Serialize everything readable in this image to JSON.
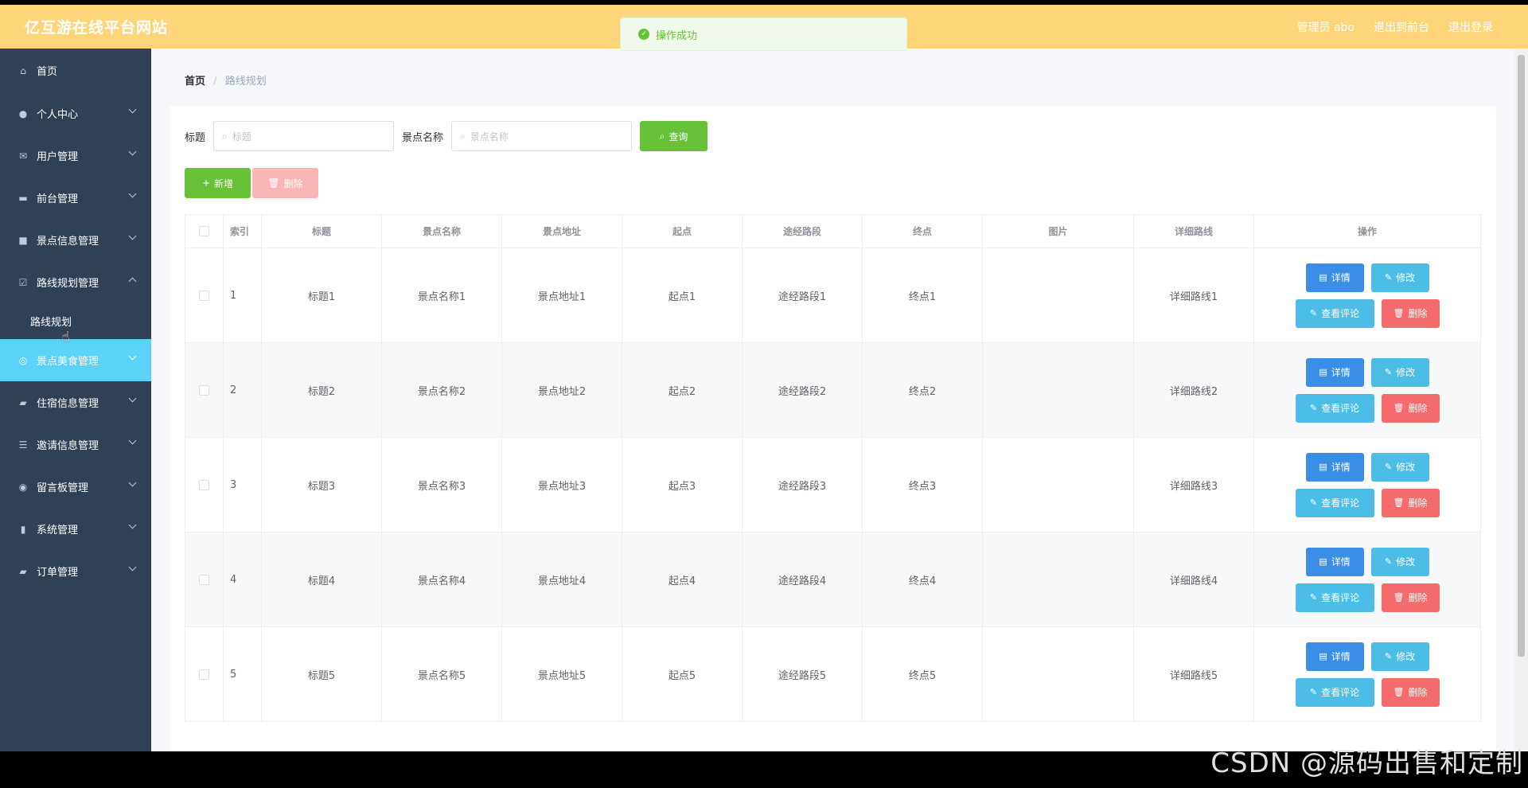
{
  "header": {
    "brand": "亿互游在线平台网站",
    "admin": "管理员 abo",
    "back_frontend": "退出到前台",
    "logout": "退出登录"
  },
  "toast": {
    "message": "操作成功"
  },
  "sidebar": {
    "items": [
      {
        "label": "首页",
        "icon": "home-icon"
      },
      {
        "label": "个人中心",
        "icon": "user-icon"
      },
      {
        "label": "用户管理",
        "icon": "mail-icon"
      },
      {
        "label": "前台管理",
        "icon": "printer-icon"
      },
      {
        "label": "景点信息管理",
        "icon": "briefcase-icon"
      },
      {
        "label": "路线规划管理",
        "icon": "checklist-icon"
      },
      {
        "label": "路线规划",
        "icon": ""
      },
      {
        "label": "景点美食管理",
        "icon": "compass-icon"
      },
      {
        "label": "住宿信息管理",
        "icon": "wallet-icon"
      },
      {
        "label": "邀请信息管理",
        "icon": "sliders-icon"
      },
      {
        "label": "留言板管理",
        "icon": "target-icon"
      },
      {
        "label": "系统管理",
        "icon": "chart-icon"
      },
      {
        "label": "订单管理",
        "icon": "chat-icon"
      }
    ]
  },
  "breadcrumb": {
    "home": "首页",
    "current": "路线规划"
  },
  "search": {
    "title_label": "标题",
    "title_placeholder": "标题",
    "spot_label": "景点名称",
    "spot_placeholder": "景点名称",
    "query": "查询"
  },
  "actions": {
    "add": "新增",
    "delete": "删除"
  },
  "table": {
    "headers": [
      "索引",
      "标题",
      "景点名称",
      "景点地址",
      "起点",
      "途经路段",
      "终点",
      "图片",
      "详细路线",
      "操作"
    ],
    "rows": [
      {
        "idx": "1",
        "title": "标题1",
        "spot": "景点名称1",
        "addr": "景点地址1",
        "start": "起点1",
        "via": "途经路段1",
        "end": "终点1",
        "route": "详细路线1"
      },
      {
        "idx": "2",
        "title": "标题2",
        "spot": "景点名称2",
        "addr": "景点地址2",
        "start": "起点2",
        "via": "途经路段2",
        "end": "终点2",
        "route": "详细路线2"
      },
      {
        "idx": "3",
        "title": "标题3",
        "spot": "景点名称3",
        "addr": "景点地址3",
        "start": "起点3",
        "via": "途经路段3",
        "end": "终点3",
        "route": "详细路线3"
      },
      {
        "idx": "4",
        "title": "标题4",
        "spot": "景点名称4",
        "addr": "景点地址4",
        "start": "起点4",
        "via": "途经路段4",
        "end": "终点4",
        "route": "详细路线4"
      },
      {
        "idx": "5",
        "title": "标题5",
        "spot": "景点名称5",
        "addr": "景点地址5",
        "start": "起点5",
        "via": "途经路段5",
        "end": "终点5",
        "route": "详细路线5"
      }
    ],
    "op_labels": {
      "detail": "详情",
      "edit": "修改",
      "comment": "查看评论",
      "delete": "删除"
    }
  },
  "watermark": "CSDN @源码出售和定制",
  "colors": {
    "header": "#ffd57a",
    "sidebar": "#304156",
    "active": "#5bd2f8",
    "success": "#67c23a",
    "danger": "#f56c6c"
  }
}
